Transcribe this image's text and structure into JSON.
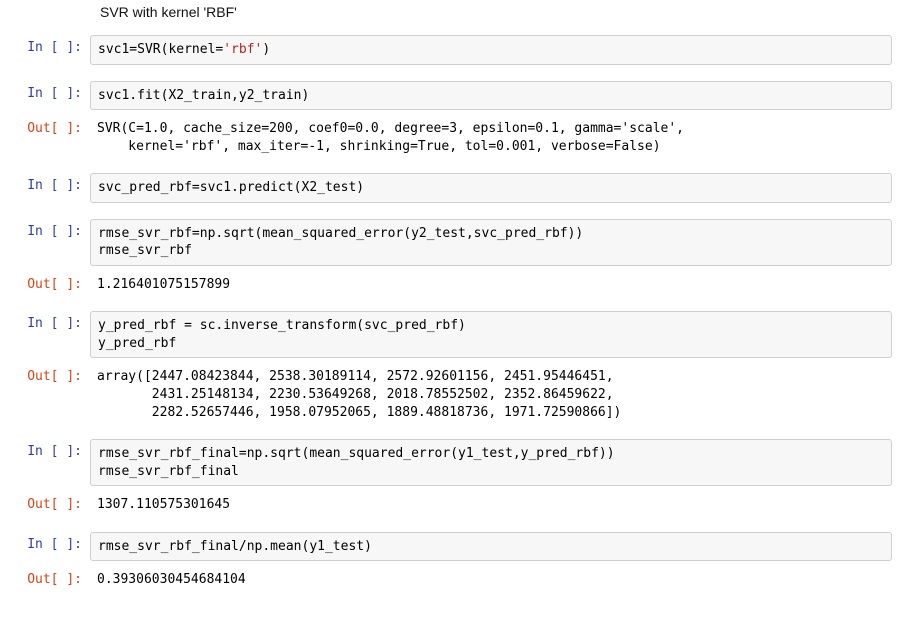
{
  "header": "SVR with kernel 'RBF'",
  "cells": [
    {
      "type": "in",
      "prompt": "In [ ]:",
      "code": "svc1=SVR(kernel='rbf')"
    },
    {
      "type": "in",
      "prompt": "In [ ]:",
      "code": "svc1.fit(X2_train,y2_train)"
    },
    {
      "type": "out",
      "prompt": "Out[ ]:",
      "text": "SVR(C=1.0, cache_size=200, coef0=0.0, degree=3, epsilon=0.1, gamma='scale',\n    kernel='rbf', max_iter=-1, shrinking=True, tol=0.001, verbose=False)"
    },
    {
      "type": "in",
      "prompt": "In [ ]:",
      "code": "svc_pred_rbf=svc1.predict(X2_test)"
    },
    {
      "type": "in",
      "prompt": "In [ ]:",
      "code": "rmse_svr_rbf=np.sqrt(mean_squared_error(y2_test,svc_pred_rbf))\nrmse_svr_rbf"
    },
    {
      "type": "out",
      "prompt": "Out[ ]:",
      "text": "1.216401075157899"
    },
    {
      "type": "in",
      "prompt": "In [ ]:",
      "code": "y_pred_rbf = sc.inverse_transform(svc_pred_rbf)\ny_pred_rbf"
    },
    {
      "type": "out",
      "prompt": "Out[ ]:",
      "text": "array([2447.08423844, 2538.30189114, 2572.92601156, 2451.95446451,\n       2431.25148134, 2230.53649268, 2018.78552502, 2352.86459622,\n       2282.52657446, 1958.07952065, 1889.48818736, 1971.72590866])"
    },
    {
      "type": "in",
      "prompt": "In [ ]:",
      "code": "rmse_svr_rbf_final=np.sqrt(mean_squared_error(y1_test,y_pred_rbf))\nrmse_svr_rbf_final"
    },
    {
      "type": "out",
      "prompt": "Out[ ]:",
      "text": "1307.110575301645"
    },
    {
      "type": "in",
      "prompt": "In [ ]:",
      "code": "rmse_svr_rbf_final/np.mean(y1_test)"
    },
    {
      "type": "out",
      "prompt": "Out[ ]:",
      "text": "0.39306030454684104"
    }
  ]
}
